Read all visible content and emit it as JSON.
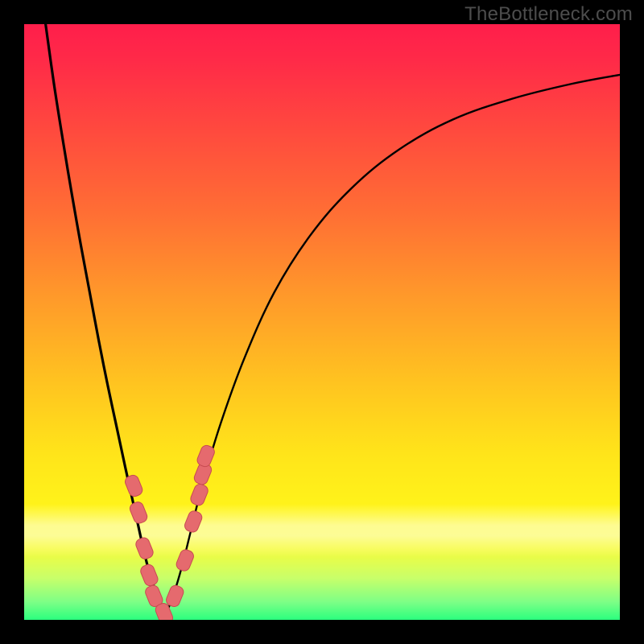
{
  "watermark": {
    "text": "TheBottleneck.com"
  },
  "colors": {
    "curve": "#000000",
    "marker_fill": "#e56a6e",
    "marker_stroke": "#c84b51",
    "gradient_stops": [
      "#ff1e4b",
      "#ff6f34",
      "#ffe41a",
      "#2bff7e"
    ]
  },
  "chart_data": {
    "type": "line",
    "title": "",
    "xlabel": "",
    "ylabel": "",
    "xlim": [
      0,
      100
    ],
    "ylim": [
      0,
      100
    ],
    "grid": false,
    "legend": false,
    "note": "Axis values are fractional positions (0–100) of the plot area; no numeric ticks are shown in the source image. Curve/markers are estimated from pixel positions.",
    "series": [
      {
        "name": "left-branch",
        "x": [
          3.6,
          5.0,
          6.5,
          8.0,
          9.5,
          11.0,
          12.5,
          14.0,
          15.5,
          17.0,
          18.0,
          19.0,
          20.0,
          21.0,
          22.0,
          23.0,
          23.8
        ],
        "y": [
          100.0,
          90.0,
          80.5,
          71.5,
          63.0,
          55.0,
          47.0,
          39.5,
          32.5,
          25.5,
          21.0,
          16.5,
          12.0,
          8.0,
          5.0,
          2.5,
          1.0
        ]
      },
      {
        "name": "right-branch",
        "x": [
          23.8,
          25.0,
          26.5,
          28.0,
          30.0,
          33.0,
          37.0,
          42.0,
          48.0,
          55.0,
          63.0,
          72.0,
          82.0,
          92.0,
          100.0
        ],
        "y": [
          1.0,
          4.0,
          9.0,
          15.0,
          23.0,
          33.0,
          44.0,
          55.0,
          64.5,
          72.5,
          79.0,
          84.0,
          87.5,
          90.0,
          91.5
        ]
      },
      {
        "name": "markers",
        "type": "scatter",
        "x": [
          18.4,
          19.2,
          20.2,
          21.0,
          21.8,
          23.5,
          25.3,
          27.0,
          28.4,
          29.4,
          30.0,
          30.5
        ],
        "y": [
          22.5,
          18.0,
          12.0,
          7.5,
          4.0,
          1.0,
          4.0,
          10.0,
          16.5,
          21.0,
          24.5,
          27.5
        ]
      }
    ]
  }
}
